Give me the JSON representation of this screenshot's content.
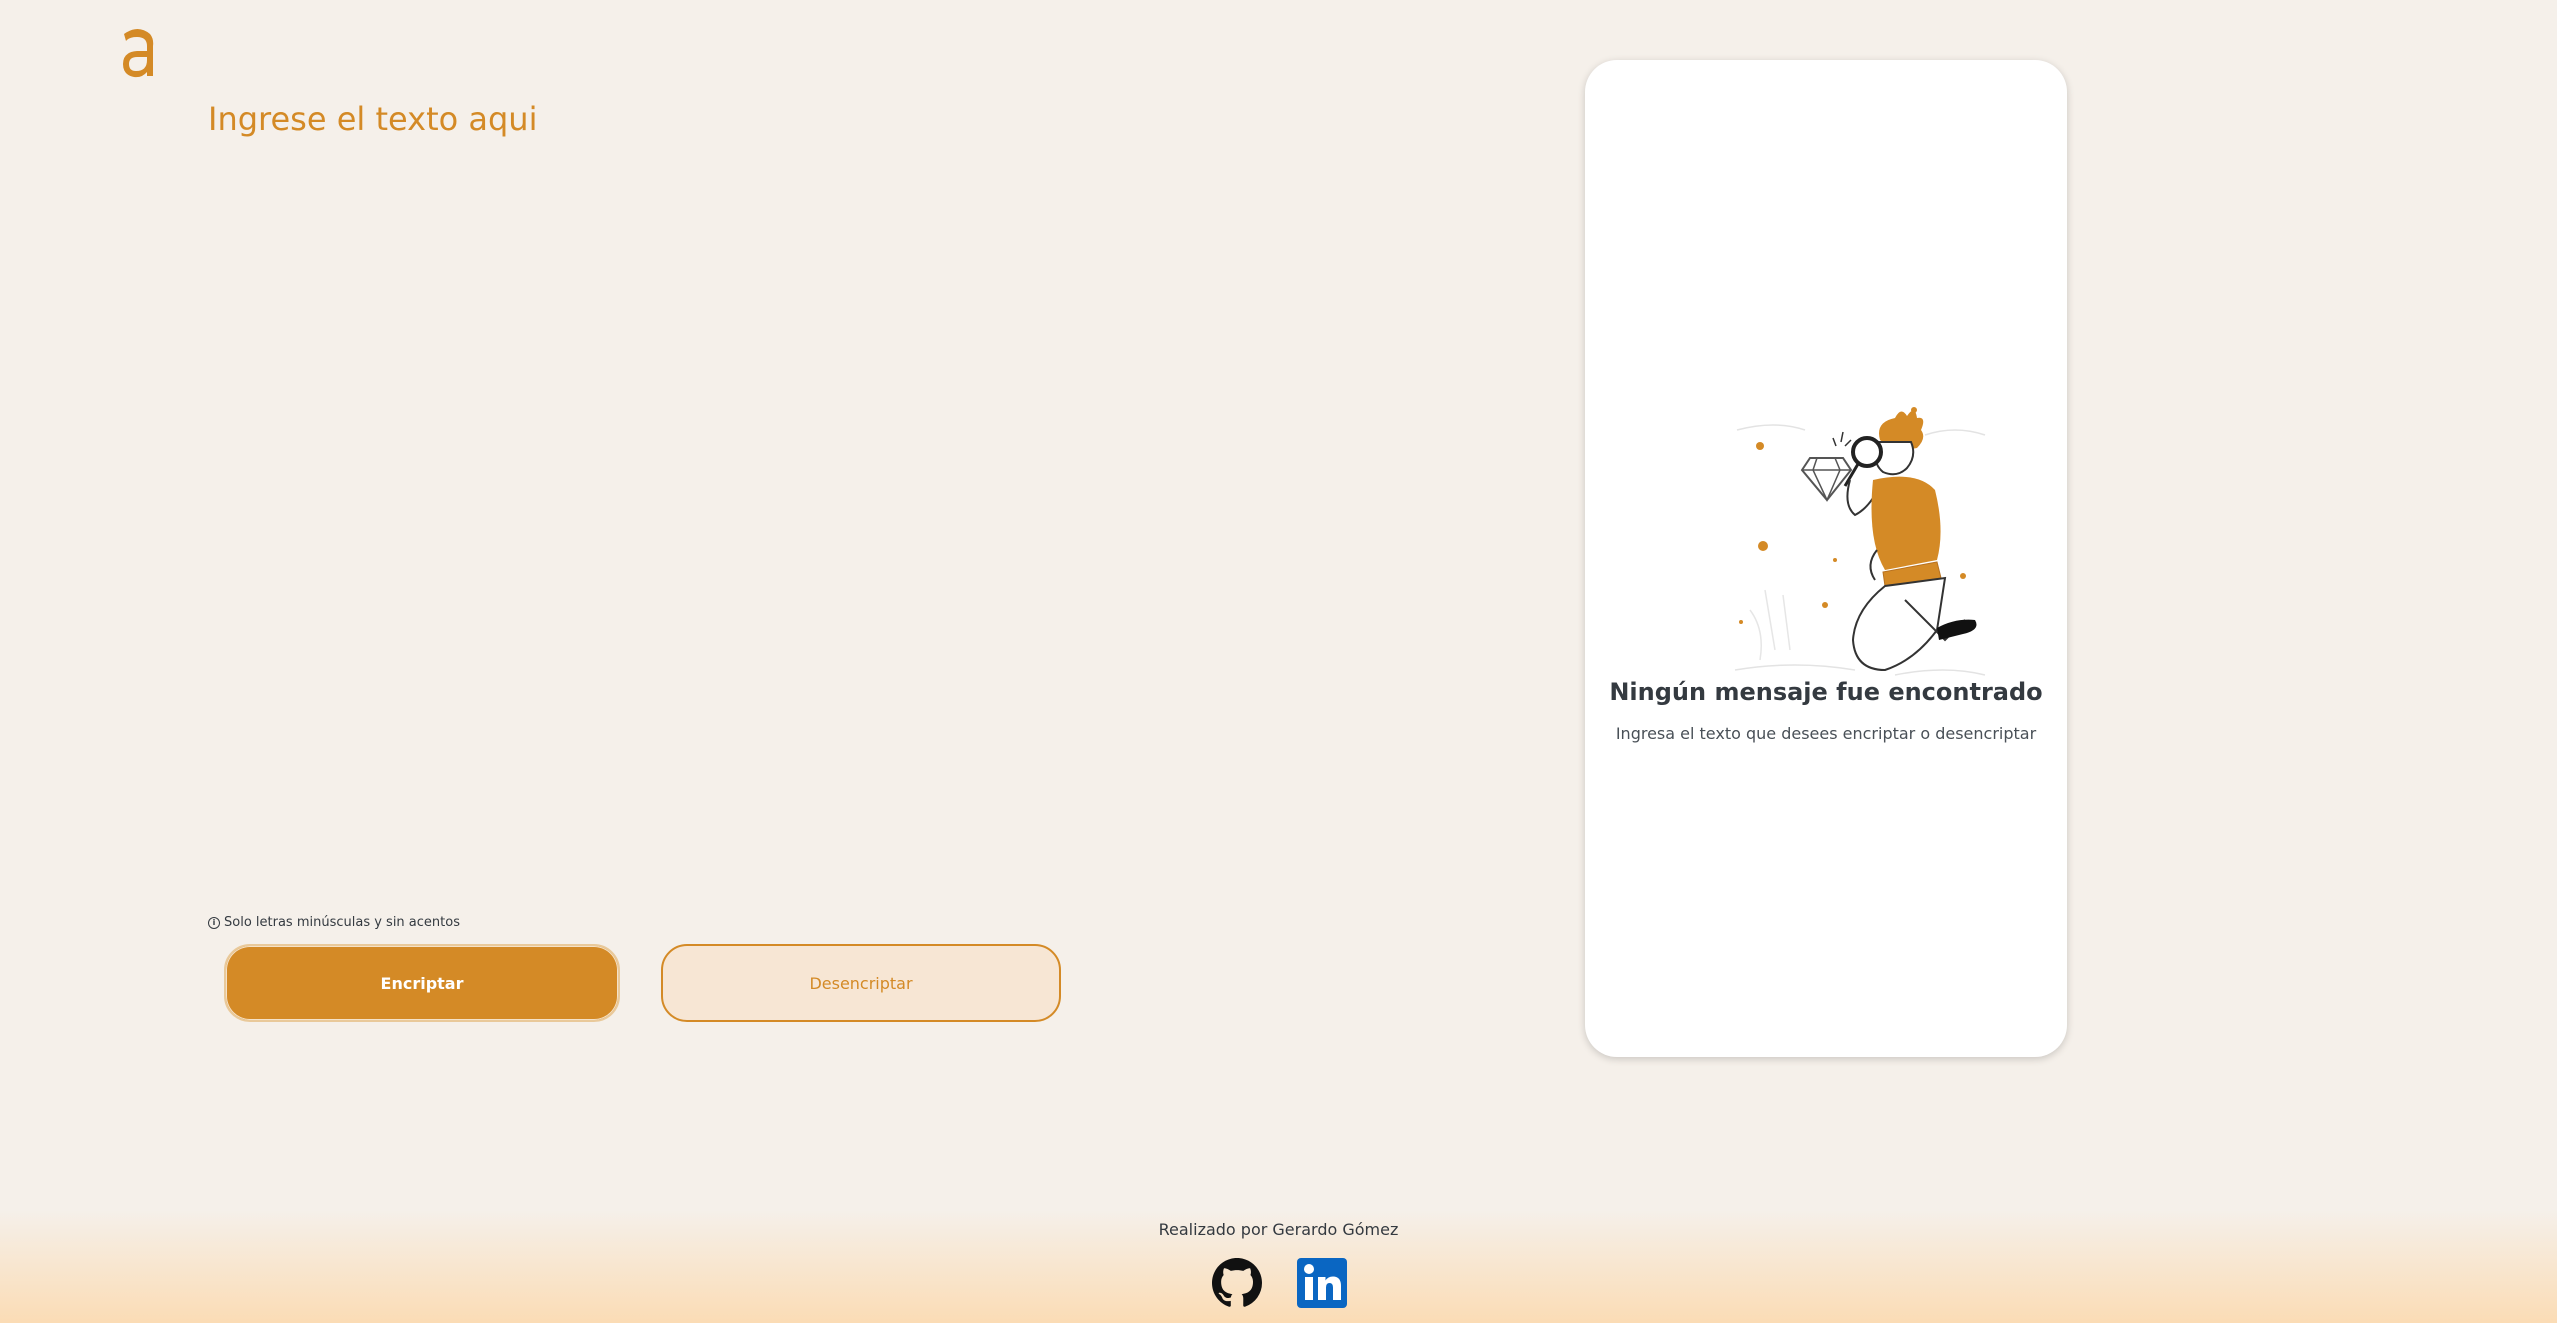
{
  "app": {
    "logo_letter": "a",
    "accent_color": "#d48a26"
  },
  "input": {
    "placeholder": "Ingrese el texto aqui",
    "value": ""
  },
  "hint": {
    "icon": "info-icon",
    "text": "Solo letras minúsculas y sin acentos"
  },
  "buttons": {
    "encrypt_label": "Encriptar",
    "decrypt_label": "Desencriptar"
  },
  "result": {
    "illustration": "person-with-magnifier-illustration",
    "title": "Ningún mensaje fue encontrado",
    "subtitle": "Ingresa el texto que desees encriptar o desencriptar"
  },
  "footer": {
    "credit": "Realizado por Gerardo Gómez",
    "links": [
      {
        "icon": "github-icon"
      },
      {
        "icon": "linkedin-icon"
      }
    ]
  }
}
